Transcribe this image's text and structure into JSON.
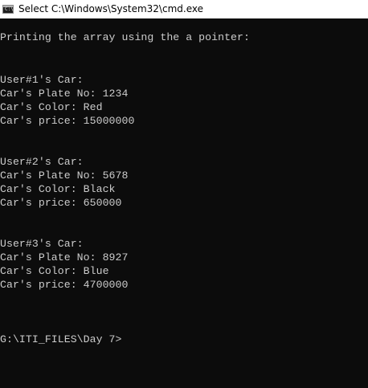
{
  "window": {
    "title": "Select C:\\Windows\\System32\\cmd.exe",
    "icon": "cmd-icon"
  },
  "console": {
    "lines": [
      "Printing the array using the a pointer:",
      "User#1's Car:",
      "Car's Plate No: 1234",
      "Car's Color: Red",
      "Car's price: 15000000",
      "User#2's Car:",
      "Car's Plate No: 5678",
      "Car's Color: Black",
      "Car's price: 650000",
      "User#3's Car:",
      "Car's Plate No: 8927",
      "Car's Color: Blue",
      "Car's price: 4700000",
      "G:\\ITI_FILES\\Day 7>"
    ],
    "text_color": "#cccccc",
    "background_color": "#0c0c0c"
  }
}
